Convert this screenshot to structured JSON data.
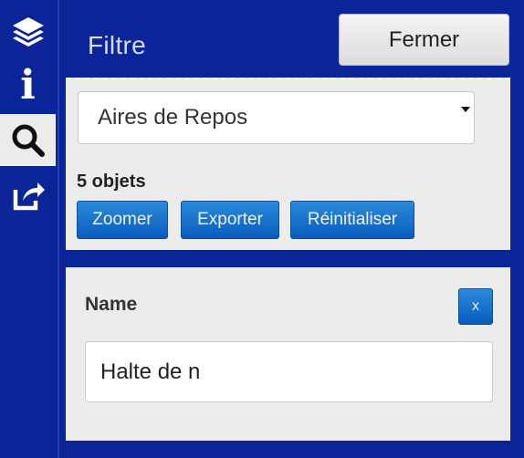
{
  "rail": {
    "items": [
      {
        "icon": "layers-icon"
      },
      {
        "icon": "info-icon",
        "glyph": "i"
      },
      {
        "icon": "search-icon"
      },
      {
        "icon": "share-icon"
      }
    ]
  },
  "header": {
    "title": "Filtre",
    "close_label": "Fermer"
  },
  "filter": {
    "selected_layer": "Aires de Repos",
    "count_text": "5 objets",
    "buttons": {
      "zoom": "Zoomer",
      "export": "Exporter",
      "reset": "Réinitialiser"
    }
  },
  "field": {
    "label": "Name",
    "remove_label": "x",
    "value": "Halte de n"
  },
  "colors": {
    "background": "#0b2497",
    "panel": "#ececec",
    "button_blue": "#0a5cc0"
  }
}
